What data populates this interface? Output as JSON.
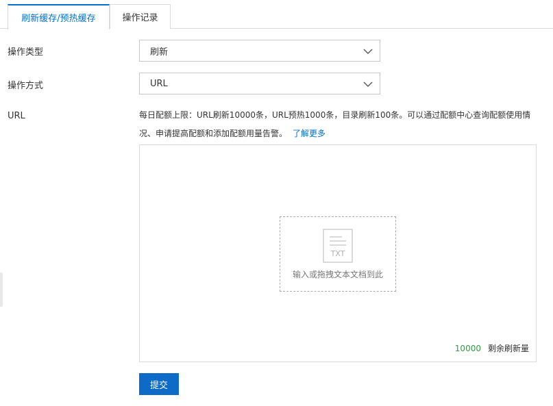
{
  "tabs": [
    {
      "label": "刷新缓存/预热缓存",
      "active": true
    },
    {
      "label": "操作记录",
      "active": false
    }
  ],
  "form": {
    "op_type": {
      "label": "操作类型",
      "value": "刷新"
    },
    "op_method": {
      "label": "操作方式",
      "value": "URL"
    },
    "url": {
      "label": "URL",
      "hint": "每日配额上限：URL刷新10000条，URL预热1000条，目录刷新100条。可以通过配额中心查询配额使用情况、申请提高配额和添加配额用量告警。",
      "learn_more": "了解更多",
      "drop_icon_text": "TXT",
      "drop_text": "输入或拖拽文本文档到此",
      "remaining_count": "10000",
      "remaining_label": "剩余刷新量"
    },
    "submit_label": "提交"
  },
  "colors": {
    "accent": "#0070cc",
    "button": "#0d6ac6",
    "count_green": "#2e9b3f"
  }
}
